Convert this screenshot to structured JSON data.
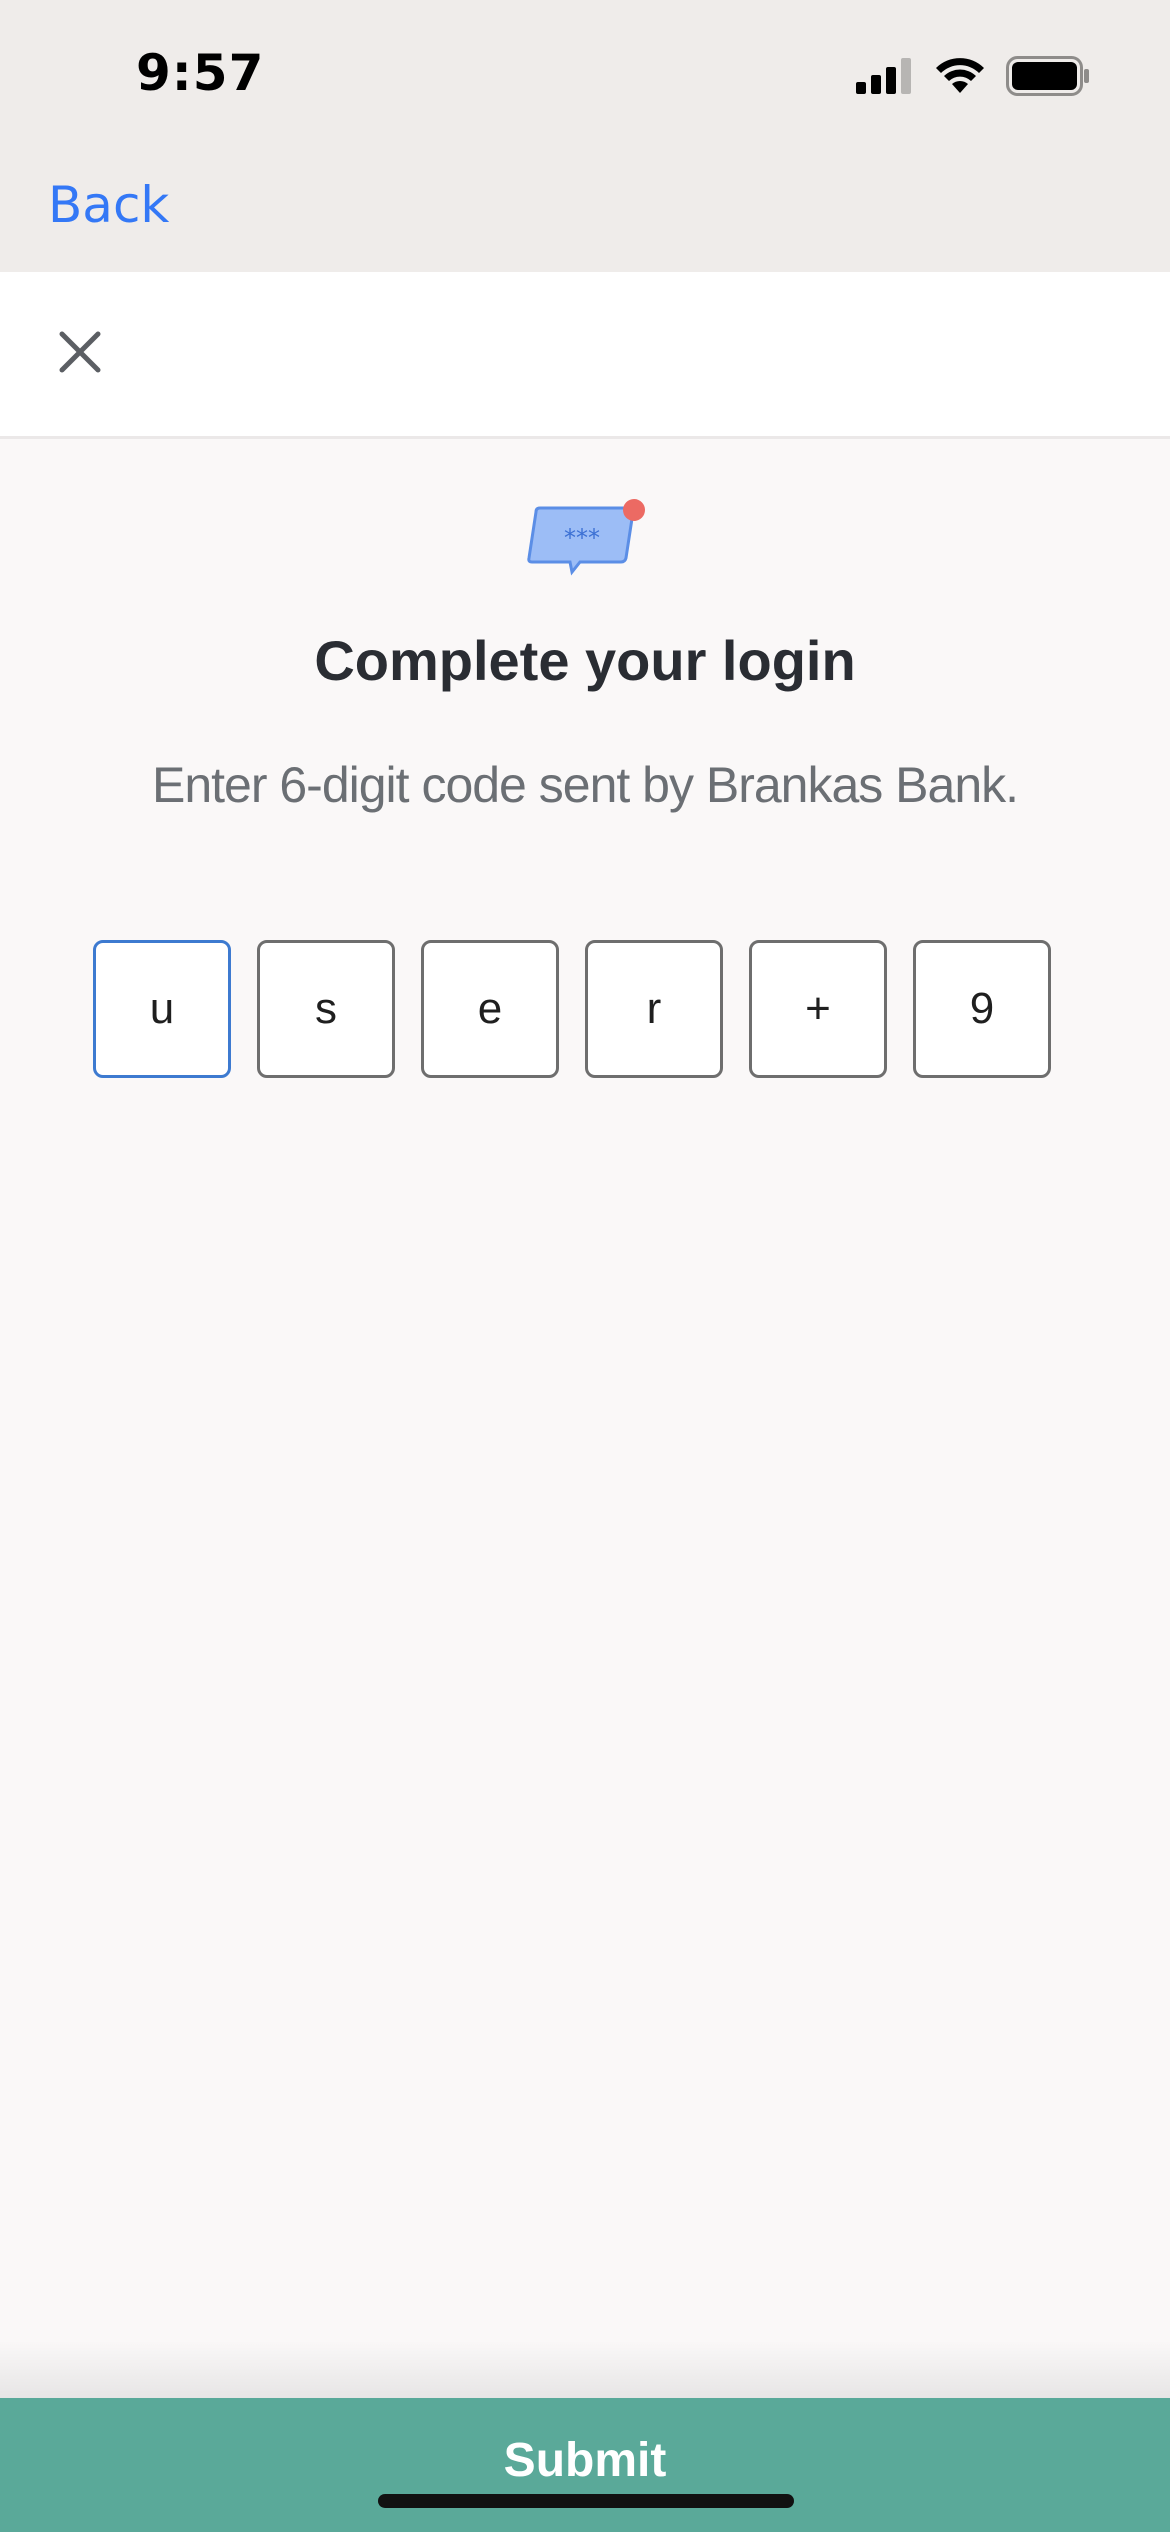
{
  "status_bar": {
    "time": "9:57",
    "signal_icon": "cellular-signal-icon",
    "wifi_icon": "wifi-icon",
    "battery_icon": "battery-icon"
  },
  "nav": {
    "back_label": "Back"
  },
  "modal": {
    "close_icon": "close-icon"
  },
  "content": {
    "illustration_icon": "otp-message-icon",
    "illustration_text": "***",
    "title": "Complete your login",
    "subtitle": "Enter 6-digit code sent by Brankas Bank."
  },
  "otp": {
    "digits": [
      "u",
      "s",
      "e",
      "r",
      "+",
      "9"
    ],
    "active_index": 0
  },
  "footer": {
    "submit_label": "Submit"
  },
  "colors": {
    "accent_link": "#3478f6",
    "submit_bg": "#5aa999",
    "active_border": "#3d7ad0",
    "notification_dot": "#ec6a63"
  }
}
